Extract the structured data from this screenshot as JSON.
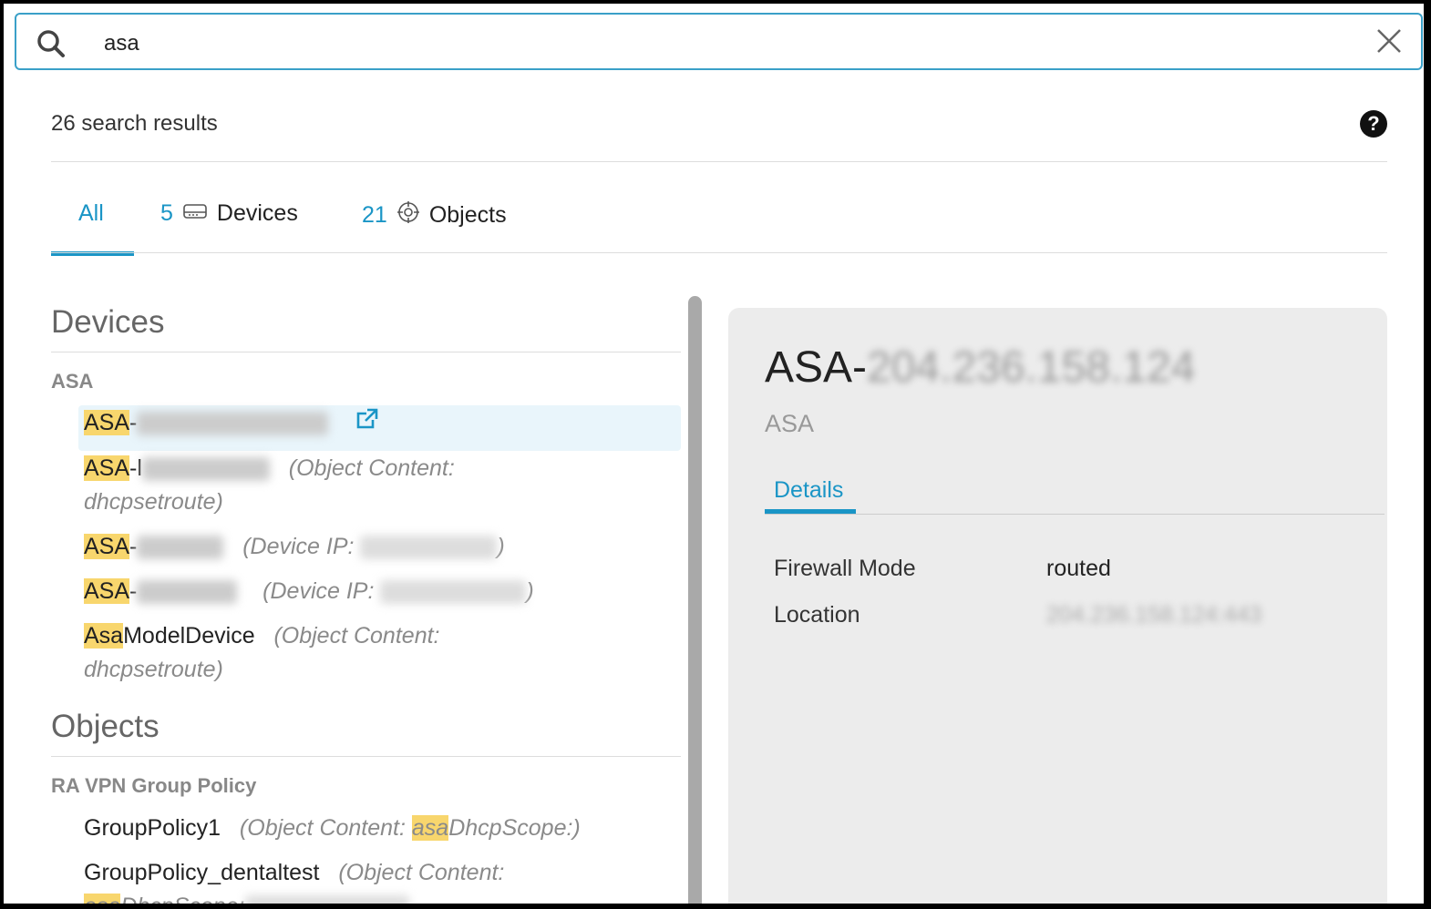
{
  "search": {
    "query": "asa"
  },
  "results": {
    "count_label": "26 search results",
    "help": "?"
  },
  "tabs": [
    {
      "label": "All"
    },
    {
      "count": "5",
      "label": "Devices"
    },
    {
      "count": "21",
      "label": "Objects"
    }
  ],
  "devices": {
    "heading": "Devices",
    "group": "ASA",
    "items": [
      {
        "match": "ASA",
        "rest": "-"
      },
      {
        "match": "ASA",
        "rest": "-l",
        "note": "(Object Content:",
        "note2": "dhcpsetroute)"
      },
      {
        "match": "ASA",
        "rest": "-",
        "note": "(Device IP:",
        "close": ")"
      },
      {
        "match": "ASA",
        "rest": "-",
        "note": "(Device IP:",
        "close": ")"
      },
      {
        "match": "Asa",
        "rest": "ModelDevice",
        "note": "(Object Content:",
        "note2": "dhcpsetroute)"
      }
    ]
  },
  "objects": {
    "heading": "Objects",
    "group": "RA VPN Group Policy",
    "items": [
      {
        "name": "GroupPolicy1",
        "note": "(Object Content: ",
        "match": "asa",
        "rest": "DhcpScope:)"
      },
      {
        "name": "GroupPolicy_dentaltest",
        "note": "(Object Content:",
        "match": "asa",
        "rest": "DhcpScope:"
      }
    ]
  },
  "detail": {
    "title_prefix": "ASA-",
    "title_ip": "204.236.158.124",
    "type": "ASA",
    "tab": "Details",
    "fields": [
      {
        "label": "Firewall Mode",
        "value": "routed"
      },
      {
        "label": "Location",
        "value": "204.236.158.124:443"
      }
    ]
  }
}
